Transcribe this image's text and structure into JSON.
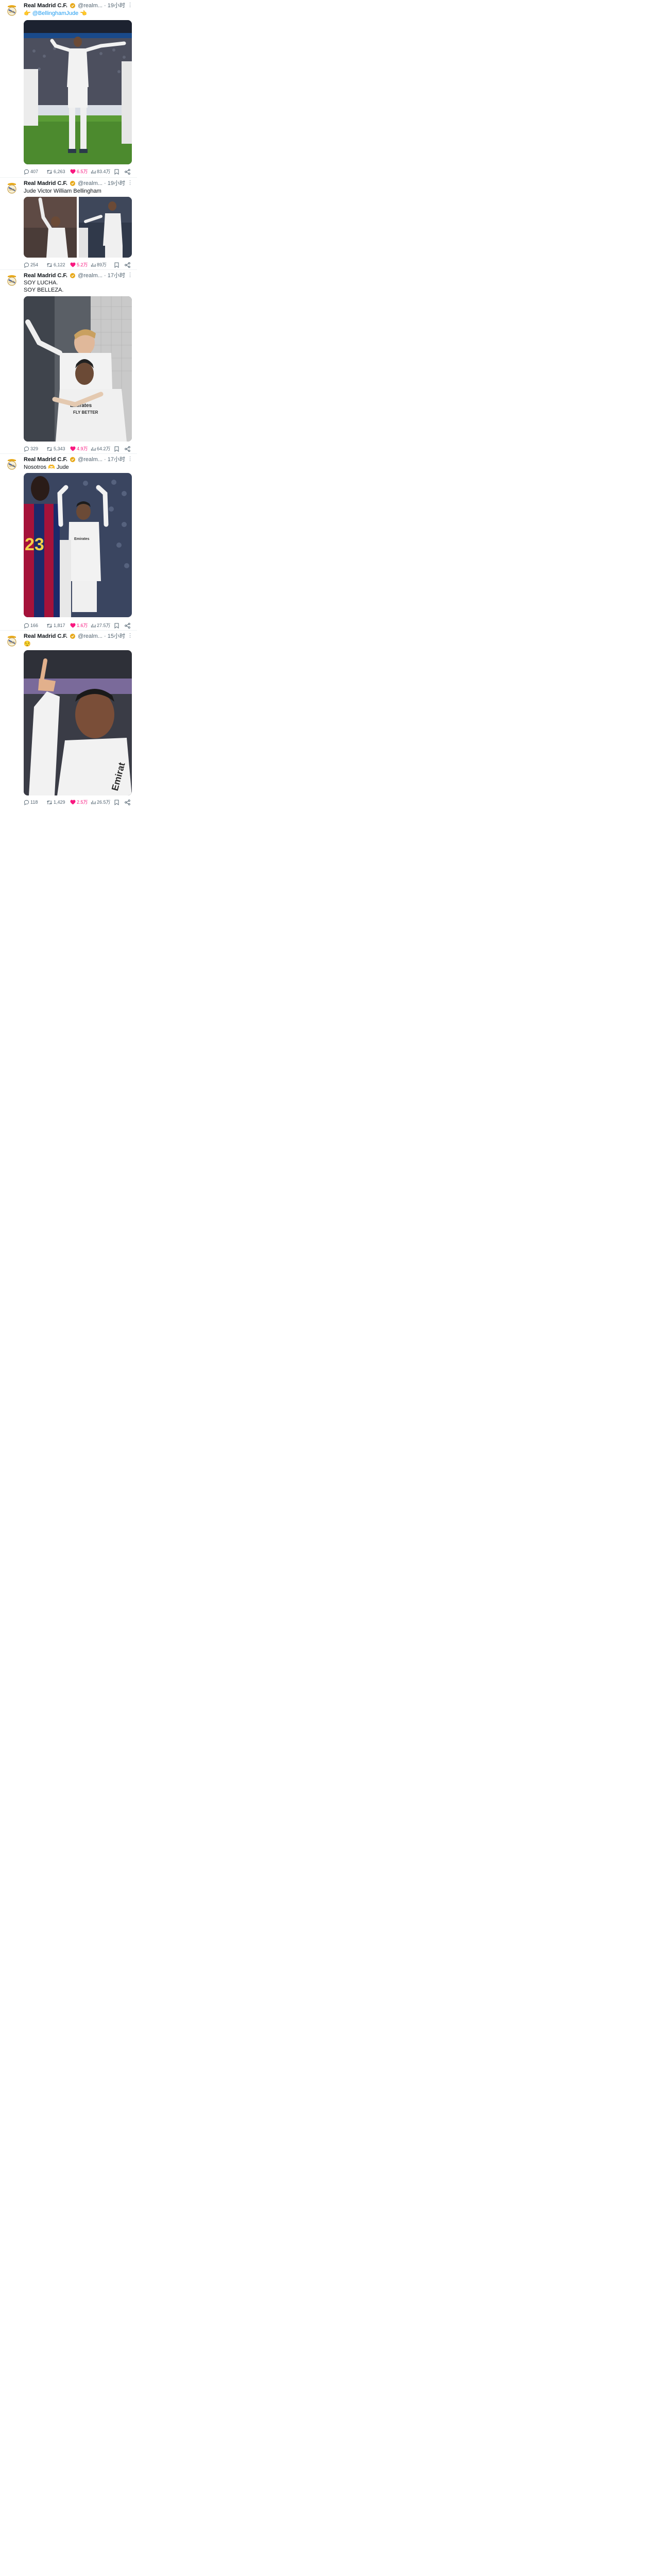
{
  "account": {
    "name": "Real Madrid C.F.",
    "handle": "@realm...",
    "verified_color": "#e8a91a"
  },
  "more_icon": "more-dots-icon",
  "colors": {
    "accent": "#1d9bf0",
    "like": "#f91880",
    "muted": "#536471"
  },
  "tweets": [
    {
      "time": "19小时",
      "lines": [
        "👉 @BellinghamJude 👈"
      ],
      "mention": "@BellinghamJude",
      "stats": {
        "replies": "407",
        "retweets": "6,263",
        "likes": "6.5万",
        "views": "83.4万"
      }
    },
    {
      "time": "19小时",
      "lines": [
        "Jude Victor William Bellingham"
      ],
      "stats": {
        "replies": "254",
        "retweets": "6,122",
        "likes": "5.2万",
        "views": "89万"
      }
    },
    {
      "time": "17小时",
      "lines": [
        "SOY LUCHA.",
        "SOY BELLEZA."
      ],
      "stats": {
        "replies": "329",
        "retweets": "5,343",
        "likes": "4.9万",
        "views": "64.2万"
      }
    },
    {
      "time": "17小时",
      "lines": [
        "Nosotros 🫶 Jude"
      ],
      "stats": {
        "replies": "166",
        "retweets": "1,817",
        "likes": "1.6万",
        "views": "27.5万"
      }
    },
    {
      "time": "15小时",
      "lines": [
        "😌"
      ],
      "stats": {
        "replies": "118",
        "retweets": "1,429",
        "likes": "2.5万",
        "views": "26.5万"
      }
    }
  ]
}
